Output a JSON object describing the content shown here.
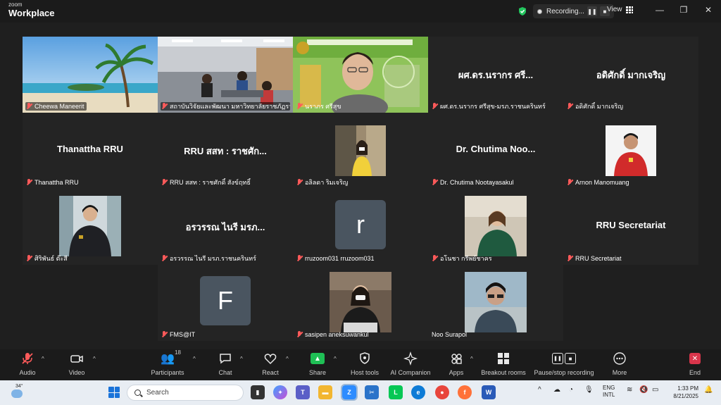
{
  "app": {
    "brand_top": "zoom",
    "brand_name": "Workplace"
  },
  "titlebar": {
    "recording_label": "Recording...",
    "view_label": "View",
    "minimize": "—",
    "restore": "❐",
    "close": "✕"
  },
  "tiles": [
    {
      "label": "Cheewa Maneerit",
      "kind": "photo"
    },
    {
      "label": "สถาบันวิจัยและพัฒนา มหาวิทยาลัยราชภัฏราช...",
      "kind": "photo"
    },
    {
      "label": "นราภร ศรีสุข",
      "kind": "photo",
      "active": true
    },
    {
      "label": "ผศ.ดร.นรากร ศรีสุข-มรภ.ราชนครินทร์",
      "bigname": "ผศ.ดร.นรากร ศรี...",
      "kind": "name"
    },
    {
      "label": "อดิศักดิ์ มากเจริญ",
      "bigname": "อดิศักดิ์ มากเจริญ",
      "kind": "name"
    },
    {
      "label": "Thanattha RRU",
      "bigname": "Thanattha RRU",
      "kind": "name"
    },
    {
      "label": "RRU สสท : ราชศักดิ์ สังข์ฤทธิ์",
      "bigname": "RRU สสท : ราชศัก...",
      "kind": "name"
    },
    {
      "label": "อลิลดา ริมเจริญ",
      "kind": "photo"
    },
    {
      "label": "Dr. Chutima Nootayasakul",
      "bigname": "Dr. Chutima Noo...",
      "kind": "name"
    },
    {
      "label": "Arnon Manomuang",
      "kind": "photo"
    },
    {
      "label": "ศิริพันธ์ ต๊ะสี",
      "kind": "photo"
    },
    {
      "label": "อรวรรณ ไนรี มรภ.ราชนครินทร์",
      "bigname": "อรวรรณ ไนรี มรภ...",
      "kind": "name"
    },
    {
      "label": "rruzoom031 rruzoom031",
      "avatar": "r",
      "kind": "avatar"
    },
    {
      "label": "อโนชา กรีพย์ชาคร",
      "kind": "photo"
    },
    {
      "label": "RRU Secretariat",
      "bigname": "RRU Secretariat",
      "kind": "name"
    },
    {
      "label": "FMS@IT",
      "avatar": "F",
      "kind": "avatar"
    },
    {
      "label": "sasipen aneksuwankul",
      "kind": "photo"
    },
    {
      "label": "Noo Surapol",
      "kind": "photo"
    }
  ],
  "toolbar": {
    "audio": "Audio",
    "video": "Video",
    "participants": "Participants",
    "participants_count": "18",
    "chat": "Chat",
    "react": "React",
    "share": "Share",
    "host_tools": "Host tools",
    "ai_companion": "AI Companion",
    "apps": "Apps",
    "breakout_rooms": "Breakout rooms",
    "pause_recording": "Pause/stop recording",
    "more": "More",
    "end": "End"
  },
  "taskbar": {
    "weather_temp": "34°",
    "search_placeholder": "Search",
    "lang_line1": "ENG",
    "lang_line2": "INTL",
    "time": "1:33 PM",
    "date": "8/21/2025"
  },
  "colors": {
    "active_speaker": "#23d959",
    "share": "#1fbf55",
    "end": "#d9354b",
    "muted": "#ff5a5a"
  }
}
